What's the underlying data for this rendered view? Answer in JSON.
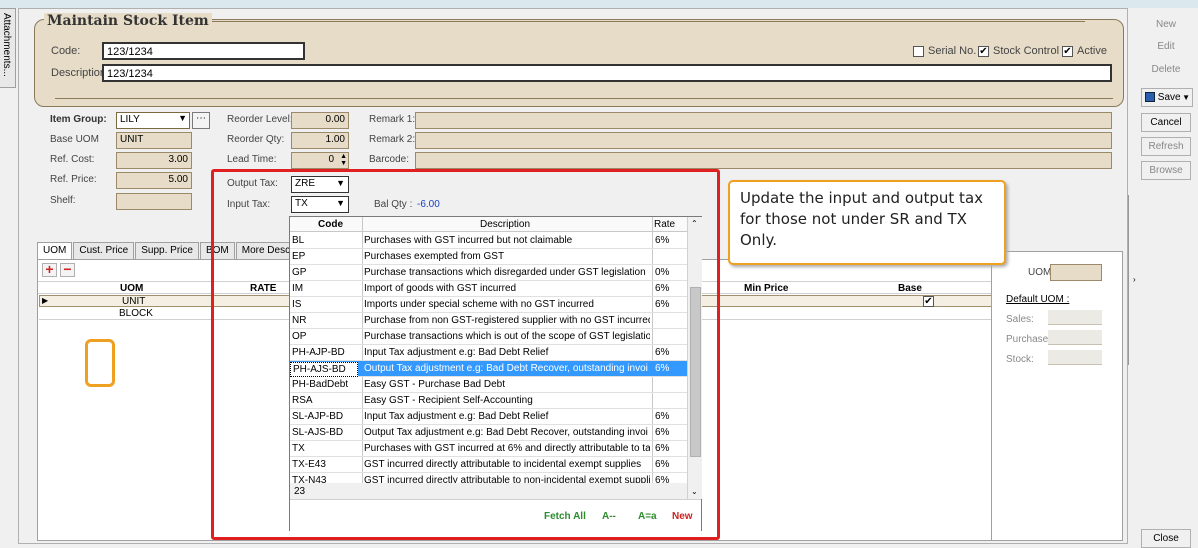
{
  "side_tab": "Attachments...",
  "header": {
    "title": "Maintain Stock Item",
    "code_label": "Code:",
    "code_value": "123/1234",
    "desc_label": "Description:",
    "desc_value": "123/1234",
    "serial_label": "Serial No.",
    "serial_checked": "",
    "stock_control_label": "Stock Control",
    "stock_control_checked": "✔",
    "active_label": "Active",
    "active_checked": "✔"
  },
  "fields": {
    "item_group_label": "Item Group:",
    "item_group_value": "LILY",
    "base_uom_label": "Base UOM",
    "base_uom_value": "UNIT",
    "ref_cost_label": "Ref. Cost:",
    "ref_cost_value": "3.00",
    "ref_price_label": "Ref. Price:",
    "ref_price_value": "5.00",
    "shelf_label": "Shelf:",
    "reorder_level_label": "Reorder Level:",
    "reorder_level_value": "0.00",
    "reorder_qty_label": "Reorder Qty:",
    "reorder_qty_value": "1.00",
    "lead_time_label": "Lead Time:",
    "lead_time_value": "0",
    "output_tax_label": "Output Tax:",
    "output_tax_value": "ZRE",
    "input_tax_label": "Input Tax:",
    "input_tax_value": "TX",
    "bal_qty_label": "Bal Qty :",
    "bal_qty_value": "-6.00",
    "remark1_label": "Remark 1:",
    "remark2_label": "Remark 2:",
    "barcode_label": "Barcode:"
  },
  "tabs": [
    "UOM",
    "Cust. Price",
    "Supp. Price",
    "BOM",
    "More Desc."
  ],
  "uom_grid": {
    "col_uom": "UOM",
    "col_rate": "RATE",
    "col_min_price": "Min Price",
    "col_base": "Base",
    "rows": [
      {
        "uom": "UNIT",
        "base": "✔"
      },
      {
        "uom": "BLOCK",
        "base": ""
      }
    ]
  },
  "uom_panel": {
    "uom_label": "UOM:",
    "default_uom": "Default UOM :",
    "sales": "Sales:",
    "purchase": "Purchase:",
    "stock": "Stock:"
  },
  "dropdown": {
    "col_code": "Code",
    "col_desc": "Description",
    "col_rate": "Rate",
    "rows": [
      {
        "code": "BL",
        "desc": "Purchases with GST incurred but not claimable",
        "rate": "6%"
      },
      {
        "code": "EP",
        "desc": "Purchases exempted from GST",
        "rate": ""
      },
      {
        "code": "GP",
        "desc": "Purchase transactions which disregarded under GST legislation",
        "rate": "0%"
      },
      {
        "code": "IM",
        "desc": "Import of goods with GST incurred",
        "rate": "6%"
      },
      {
        "code": "IS",
        "desc": "Imports under special scheme with no GST incurred",
        "rate": "6%"
      },
      {
        "code": "NR",
        "desc": "Purchase from non GST-registered supplier with no GST incurred",
        "rate": ""
      },
      {
        "code": "OP",
        "desc": "Purchase transactions which is out of the scope of GST legislation",
        "rate": ""
      },
      {
        "code": "PH-AJP-BD",
        "desc": "Input Tax adjustment e.g: Bad Debt Relief",
        "rate": "6%"
      },
      {
        "code": "PH-AJS-BD",
        "desc": "Output Tax adjustment e.g: Bad Debt Recover, outstanding invoi",
        "rate": "6%"
      },
      {
        "code": "PH-BadDebt",
        "desc": "Easy GST - Purchase Bad Debt",
        "rate": ""
      },
      {
        "code": "RSA",
        "desc": "Easy GST - Recipient Self-Accounting",
        "rate": ""
      },
      {
        "code": "SL-AJP-BD",
        "desc": "Input Tax adjustment e.g: Bad Debt Relief",
        "rate": "6%"
      },
      {
        "code": "SL-AJS-BD",
        "desc": "Output Tax adjustment e.g: Bad Debt Recover, outstanding invoi",
        "rate": "6%"
      },
      {
        "code": "TX",
        "desc": "Purchases with GST incurred at 6% and directly attributable to ta:",
        "rate": "6%"
      },
      {
        "code": "TX-E43",
        "desc": "GST incurred directly attributable to incidental exempt supplies",
        "rate": "6%"
      },
      {
        "code": "TX-N43",
        "desc": "GST incurred directly attributable to non-incidental exempt supplie",
        "rate": "6%"
      }
    ],
    "count": "23",
    "fetch_all": "Fetch All",
    "a_dash": "A--",
    "a_eq_a": "A=a",
    "new": "New"
  },
  "callout": "Update the input and output tax for those not under SR and TX Only.",
  "right_buttons": {
    "new": "New",
    "edit": "Edit",
    "delete": "Delete",
    "save": "Save",
    "cancel": "Cancel",
    "refresh": "Refresh",
    "browse": "Browse",
    "close": "Close"
  },
  "colors": {
    "header_bg": "#e6dcc8",
    "highlight_red": "#e02020",
    "callout_orange": "#f0a020",
    "selection_blue": "#3399ff",
    "fetch_green": "#2e8b2e",
    "new_red": "#d02020"
  }
}
